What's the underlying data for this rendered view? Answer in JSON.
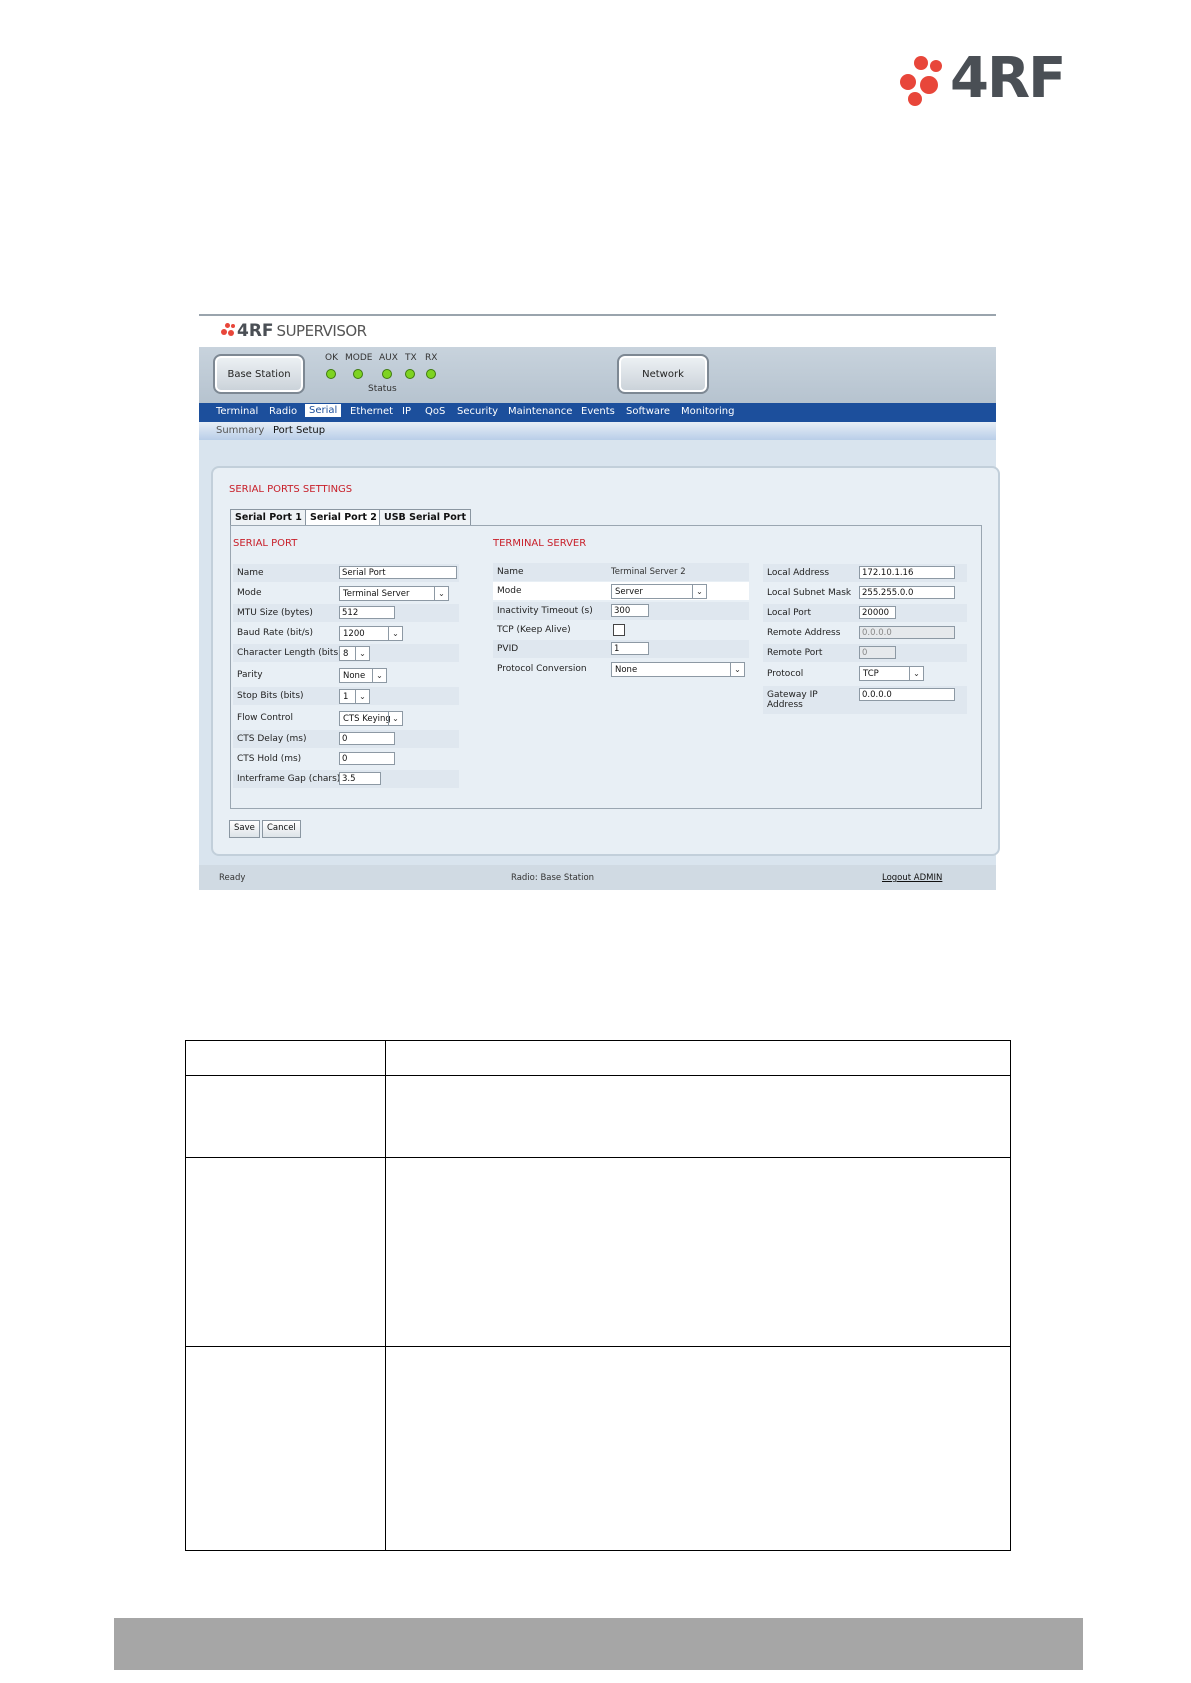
{
  "brand": {
    "name": "4RF"
  },
  "app": {
    "logo_main": "4RF",
    "logo_sub": "SUPERVISOR"
  },
  "toolbar": {
    "base_station_label": "Base Station",
    "network_label": "Network",
    "leds": [
      "OK",
      "MODE",
      "AUX",
      "TX",
      "RX"
    ],
    "status_label": "Status"
  },
  "nav": {
    "items": [
      "Terminal",
      "Radio",
      "Serial",
      "Ethernet",
      "IP",
      "QoS",
      "Security",
      "Maintenance",
      "Events",
      "Software",
      "Monitoring"
    ],
    "active": "Serial"
  },
  "subnav": {
    "items": [
      "Summary",
      "Port Setup"
    ],
    "active": "Port Setup"
  },
  "panel": {
    "title": "SERIAL PORTS SETTINGS",
    "tabs": [
      "Serial Port 1",
      "Serial Port 2",
      "USB Serial Port"
    ],
    "active_tab": "Serial Port 2"
  },
  "serial_port": {
    "title": "SERIAL PORT",
    "name_label": "Name",
    "name_value": "Serial Port",
    "mode_label": "Mode",
    "mode_value": "Terminal Server",
    "mtu_label": "MTU Size (bytes)",
    "mtu_value": "512",
    "baud_label": "Baud Rate (bit/s)",
    "baud_value": "1200",
    "charlen_label": "Character Length (bits)",
    "charlen_value": "8",
    "parity_label": "Parity",
    "parity_value": "None",
    "stopbits_label": "Stop Bits (bits)",
    "stopbits_value": "1",
    "flow_label": "Flow Control",
    "flow_value": "CTS Keying",
    "ctsdelay_label": "CTS Delay (ms)",
    "ctsdelay_value": "0",
    "ctshold_label": "CTS Hold (ms)",
    "ctshold_value": "0",
    "gap_label": "Interframe Gap (chars)",
    "gap_value": "3.5"
  },
  "terminal_server": {
    "title": "TERMINAL SERVER",
    "name_label": "Name",
    "name_value": "Terminal Server 2",
    "mode_label": "Mode",
    "mode_value": "Server",
    "inactivity_label": "Inactivity Timeout (s)",
    "inactivity_value": "300",
    "tcp_label": "TCP (Keep Alive)",
    "pvid_label": "PVID",
    "pvid_value": "1",
    "proto_conv_label": "Protocol Conversion",
    "proto_conv_value": "None"
  },
  "network": {
    "local_addr_label": "Local Address",
    "local_addr_value": "172.10.1.16",
    "subnet_label": "Local Subnet Mask",
    "subnet_value": "255.255.0.0",
    "local_port_label": "Local Port",
    "local_port_value": "20000",
    "remote_addr_label": "Remote Address",
    "remote_addr_value": "0.0.0.0",
    "remote_port_label": "Remote Port",
    "remote_port_value": "0",
    "protocol_label": "Protocol",
    "protocol_value": "TCP",
    "gateway_label_1": "Gateway IP",
    "gateway_label_2": "Address",
    "gateway_value": "0.0.0.0"
  },
  "actions": {
    "save": "Save",
    "cancel": "Cancel"
  },
  "status": {
    "left": "Ready",
    "center": "Radio: Base Station",
    "right": "Logout ADMIN"
  }
}
